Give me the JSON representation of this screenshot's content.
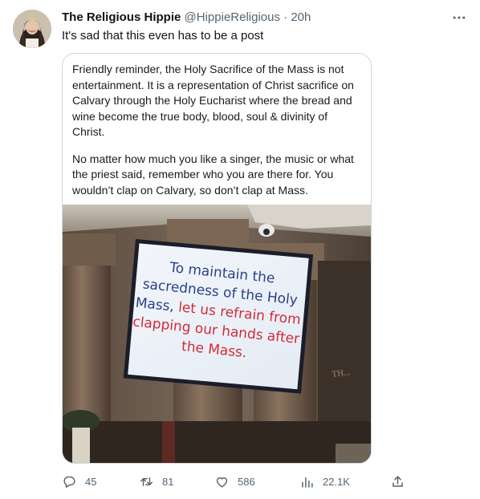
{
  "tweet": {
    "author_name": "The Religious Hippie",
    "handle": "@HippieReligious",
    "separator": "·",
    "time": "20h",
    "text": "It's sad that this even has to be a post",
    "more_icon": "more-horizontal-icon"
  },
  "quote": {
    "paragraph1": "Friendly reminder, the Holy Sacrifice of the Mass is not entertainment. It is a representation of Christ sacrifice on Calvary through the Holy Eucharist where the bread and wine become the true body, blood, soul & divinity of Christ.",
    "paragraph2": "No matter how much you like a singer, the music or what the priest said, remember who you are there for. You wouldn’t clap on Calvary, so don’t clap at Mass.",
    "screen_lines": [
      {
        "text": "To maintain the",
        "color": "#2c3f86"
      },
      {
        "text": "sacredness of the Holy",
        "color": "#2c3f86"
      },
      {
        "text": "Mass,",
        "color": "#2c3f86"
      },
      {
        "text": "let us refrain from",
        "color": "#d22b35"
      },
      {
        "text": "clapping our hands after",
        "color": "#d22b35"
      },
      {
        "text": "the Mass.",
        "color": "#d22b35"
      }
    ]
  },
  "actions": {
    "replies": "45",
    "retweets": "81",
    "likes": "586",
    "views": "22.1K"
  },
  "icons": {
    "reply": "reply-icon",
    "retweet": "retweet-icon",
    "like": "heart-icon",
    "views": "views-chart-icon",
    "share": "share-icon"
  },
  "colors": {
    "text_primary": "#0f1419",
    "text_secondary": "#536471",
    "border": "#cfd9de"
  }
}
